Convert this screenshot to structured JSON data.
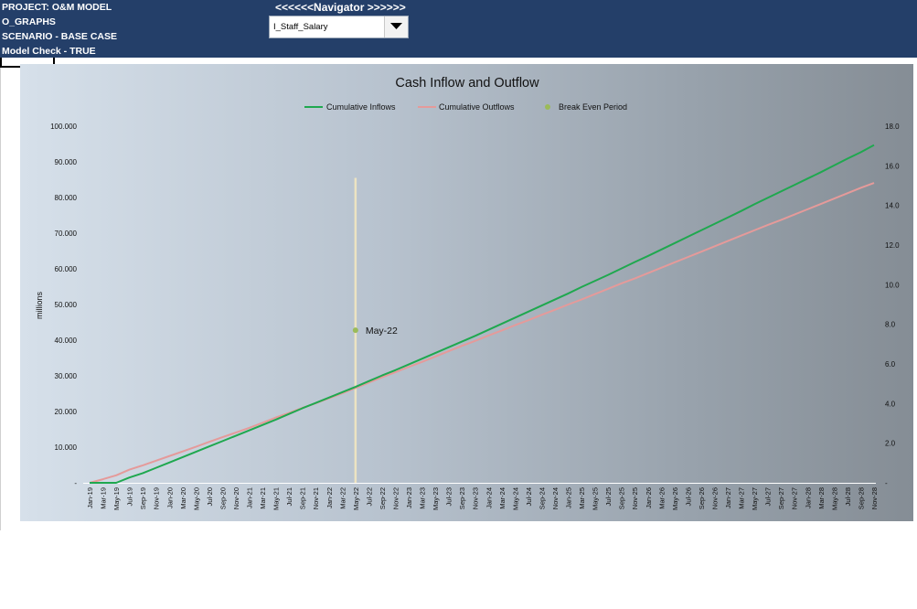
{
  "header": {
    "project": "PROJECT: O&M MODEL",
    "sheet": "O_GRAPHS",
    "scenario": "SCENARIO - BASE CASE",
    "model_check": "Model Check - TRUE"
  },
  "navigator": {
    "title": "<<<<<<Navigator >>>>>>",
    "selected": "I_Staff_Salary"
  },
  "colors": {
    "header_bg": "#243f69",
    "inflow": "#1fa84f",
    "outflow": "#e59a9a",
    "break_even": "#9bbb59",
    "break_even_line": "#ede3c2"
  },
  "chart_data": {
    "type": "line",
    "title": "Cash Inflow and Outflow",
    "ylabel": "millions",
    "legend": [
      "Cumulative Inflows",
      "Cumulative Outflows",
      "Break Even Period"
    ],
    "legend_position": "top",
    "ylim": [
      0,
      100000
    ],
    "y_ticks": [
      "-",
      "10.000",
      "20.000",
      "30.000",
      "40.000",
      "50.000",
      "60.000",
      "70.000",
      "80.000",
      "90.000",
      "100.000"
    ],
    "y2lim": [
      0,
      18
    ],
    "y2_ticks": [
      "-",
      "2.0",
      "4.0",
      "6.0",
      "8.0",
      "10.0",
      "12.0",
      "14.0",
      "16.0",
      "18.0"
    ],
    "x_labels": [
      "Jan-19",
      "Mar-19",
      "May-19",
      "Jul-19",
      "Sep-19",
      "Nov-19",
      "Jan-20",
      "Mar-20",
      "May-20",
      "Jul-20",
      "Sep-20",
      "Nov-20",
      "Jan-21",
      "Mar-21",
      "May-21",
      "Jul-21",
      "Sep-21",
      "Nov-21",
      "Jan-22",
      "Mar-22",
      "May-22",
      "Jul-22",
      "Sep-22",
      "Nov-22",
      "Jan-23",
      "Mar-23",
      "May-23",
      "Jul-23",
      "Sep-23",
      "Nov-23",
      "Jan-24",
      "Mar-24",
      "May-24",
      "Jul-24",
      "Sep-24",
      "Nov-24",
      "Jan-25",
      "Mar-25",
      "May-25",
      "Jul-25",
      "Sep-25",
      "Nov-25",
      "Jan-26",
      "Mar-26",
      "May-26",
      "Jul-26",
      "Sep-26",
      "Nov-26",
      "Jan-27",
      "Mar-27",
      "May-27",
      "Jul-27",
      "Sep-27",
      "Nov-27",
      "Jan-28",
      "Mar-28",
      "May-28",
      "Jul-28",
      "Sep-28",
      "Nov-28"
    ],
    "series": [
      {
        "name": "Cumulative Inflows",
        "values": [
          0,
          0,
          0,
          1500,
          2700,
          4200,
          5700,
          7200,
          8700,
          10200,
          11700,
          13200,
          14700,
          16200,
          17700,
          19300,
          20900,
          22400,
          23900,
          25400,
          26900,
          28500,
          30100,
          31600,
          33200,
          34800,
          36400,
          38000,
          39600,
          41200,
          42900,
          44600,
          46300,
          48000,
          49700,
          51400,
          53100,
          54900,
          56600,
          58300,
          60100,
          61900,
          63600,
          65400,
          67200,
          69000,
          70800,
          72600,
          74400,
          76200,
          78100,
          79900,
          81700,
          83500,
          85300,
          87100,
          89000,
          90900,
          92700,
          94700
        ]
      },
      {
        "name": "Cumulative Outflows",
        "values": [
          0,
          1000,
          2100,
          3700,
          4900,
          6200,
          7500,
          8800,
          10100,
          11500,
          12800,
          14100,
          15400,
          16800,
          18300,
          19600,
          21000,
          22300,
          23700,
          25100,
          26600,
          28100,
          29600,
          31000,
          32500,
          33900,
          35400,
          36900,
          38400,
          39800,
          41300,
          42700,
          44200,
          45600,
          47100,
          48500,
          50000,
          51400,
          52900,
          54400,
          55900,
          57300,
          58800,
          60300,
          61800,
          63300,
          64800,
          66300,
          67800,
          69300,
          70800,
          72300,
          73700,
          75200,
          76700,
          78200,
          79700,
          81200,
          82700,
          84100
        ]
      }
    ],
    "break_even": {
      "label": "May-22",
      "index": 20,
      "y2_value": 7.7,
      "line_top": 85500
    }
  }
}
